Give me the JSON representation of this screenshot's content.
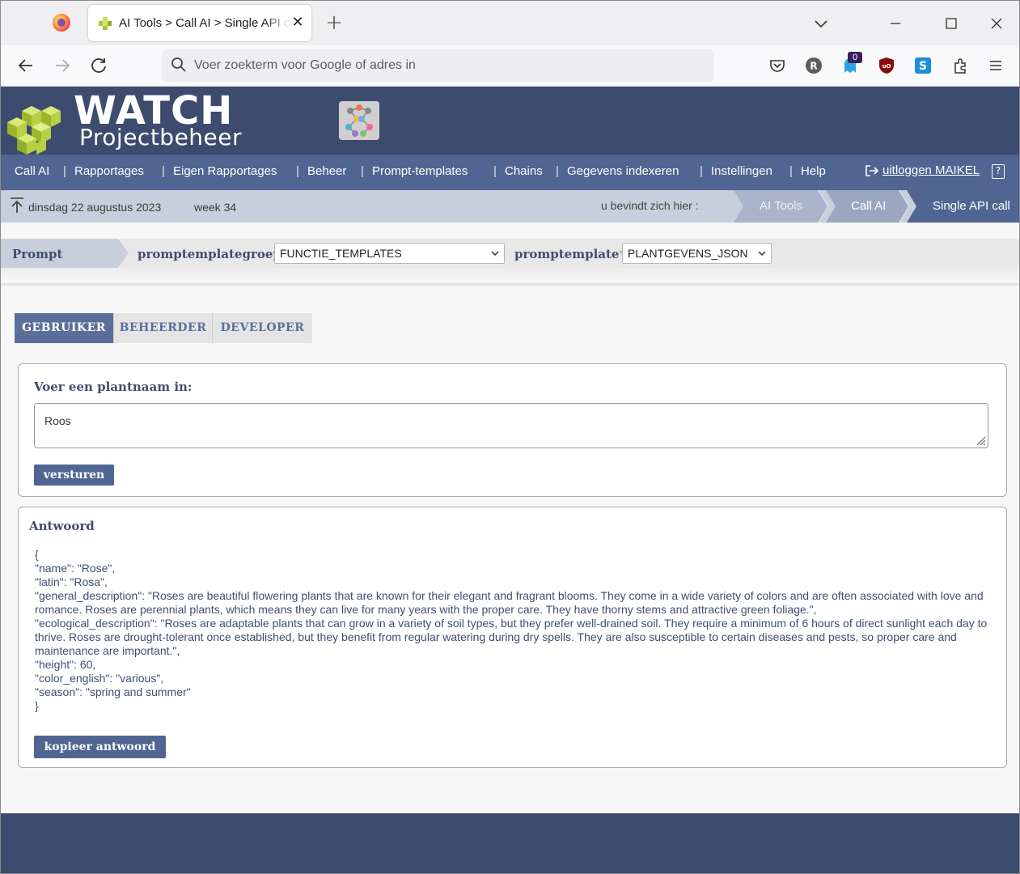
{
  "browser": {
    "tab_title": "AI Tools > Call AI > Single API call",
    "url_placeholder": "Voer zoekterm voor Google of adres in",
    "extension_badge": "0"
  },
  "header": {
    "logo_title": "WATCH",
    "logo_subtitle": "Projectbeheer"
  },
  "menu": {
    "items": [
      {
        "label": "Call AI"
      },
      {
        "label": "Rapportages"
      },
      {
        "label": "Eigen Rapportages"
      },
      {
        "label": "Beheer"
      },
      {
        "label": "Prompt-templates"
      },
      {
        "label": "Chains"
      },
      {
        "label": "Gegevens indexeren"
      },
      {
        "label": "Instellingen"
      },
      {
        "label": "Help"
      }
    ],
    "separator": "|",
    "logout_label": "uitloggen MAIKEL"
  },
  "crumbbar": {
    "date": "dinsdag 22 augustus 2023",
    "week": "week 34",
    "here_label": "u bevindt zich hier :",
    "crumbs": [
      "AI Tools",
      "Call AI",
      "Single API call"
    ]
  },
  "prompt_bar": {
    "section_label": "Prompt",
    "group_label": "promptemplategroep",
    "group_value": "FUNCTIE_TEMPLATES",
    "template_label": "promptemplate",
    "template_required_mark": "*",
    "template_value": "PLANTGEVENS_JSON"
  },
  "tabs": [
    "GEBRUIKER",
    "BEHEERDER",
    "DEVELOPER"
  ],
  "input_panel": {
    "title": "Voer een plantnaam in:",
    "value": "Roos",
    "submit_label": "versturen"
  },
  "answer_panel": {
    "title": "Antwoord",
    "text": "{\n\"name\": \"Rose\",\n\"latin\": \"Rosa\",\n\"general_description\": \"Roses are beautiful flowering plants that are known for their elegant and fragrant blooms. They come in a wide variety of colors and are often associated with love and romance. Roses are perennial plants, which means they can live for many years with the proper care. They have thorny stems and attractive green foliage.\",\n\"ecological_description\": \"Roses are adaptable plants that can grow in a variety of soil types, but they prefer well-drained soil. They require a minimum of 6 hours of direct sunlight each day to thrive. Roses are drought-tolerant once established, but they benefit from regular watering during dry spells. They are also susceptible to certain diseases and pests, so proper care and maintenance are important.\",\n\"height\": 60,\n\"color_english\": \"various\",\n\"season\": \"spring and summer\"\n}",
    "copy_label": "kopieer antwoord"
  },
  "colors": {
    "header_bg": "#3d4b6e",
    "menu_bg": "#506592",
    "crumb_bg": "#c8cfdc",
    "accent": "#5a6f98",
    "logo_green": "#a8c43a"
  },
  "icons": [
    "firefox-icon",
    "tab-favicon-icon",
    "close-icon",
    "plus-icon",
    "chevron-down-icon",
    "minimize-icon",
    "maximize-icon",
    "back-icon",
    "forward-icon",
    "reload-icon",
    "search-icon",
    "pocket-icon",
    "extensions-icon",
    "hamburger-icon",
    "logout-icon",
    "help-icon",
    "upload-icon",
    "resize-icon"
  ]
}
